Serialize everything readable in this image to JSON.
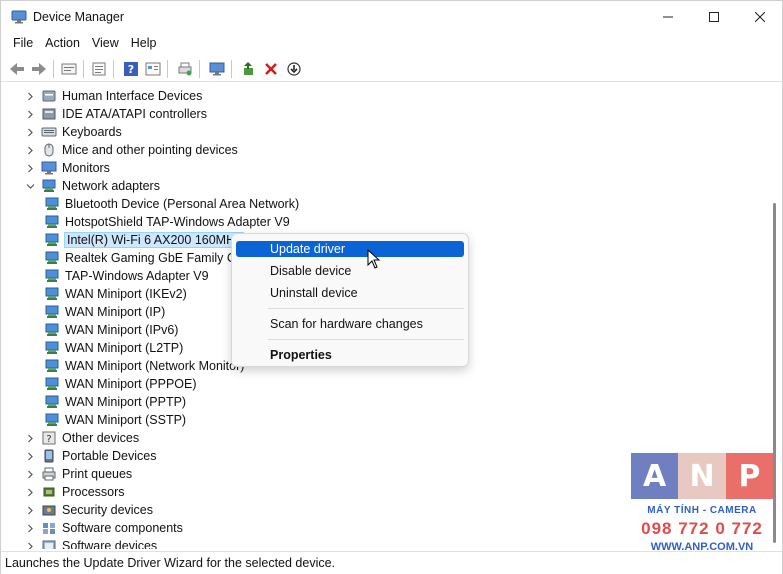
{
  "window": {
    "title": "Device Manager"
  },
  "menu": [
    "File",
    "Action",
    "View",
    "Help"
  ],
  "toolbar": {
    "icons": [
      "back-arrow-icon",
      "forward-arrow-icon",
      "computer-properties-icon",
      "show-hidden-icon",
      "help-icon",
      "view-icon",
      "scan-hardware-icon",
      "monitor-icon",
      "update-driver-icon",
      "uninstall-icon",
      "disable-icon"
    ]
  },
  "tree": {
    "rows": [
      {
        "label": "Human Interface Devices",
        "level": 0,
        "expander": "collapsed",
        "icon": "hid-icon"
      },
      {
        "label": "IDE ATA/ATAPI controllers",
        "level": 0,
        "expander": "collapsed",
        "icon": "ide-controller-icon"
      },
      {
        "label": "Keyboards",
        "level": 0,
        "expander": "collapsed",
        "icon": "keyboard-icon"
      },
      {
        "label": "Mice and other pointing devices",
        "level": 0,
        "expander": "collapsed",
        "icon": "mouse-icon"
      },
      {
        "label": "Monitors",
        "level": 0,
        "expander": "collapsed",
        "icon": "monitor-icon"
      },
      {
        "label": "Network adapters",
        "level": 0,
        "expander": "expanded",
        "icon": "network-adapter-icon"
      },
      {
        "label": "Bluetooth Device (Personal Area Network)",
        "level": 1,
        "icon": "network-adapter-icon"
      },
      {
        "label": "HotspotShield TAP-Windows Adapter V9",
        "level": 1,
        "icon": "network-adapter-icon"
      },
      {
        "label": "Intel(R) Wi-Fi 6 AX200 160MHz",
        "level": 1,
        "icon": "network-adapter-icon",
        "selected": true
      },
      {
        "label": "Realtek Gaming GbE Family Controller",
        "level": 1,
        "icon": "network-adapter-icon"
      },
      {
        "label": "TAP-Windows Adapter V9",
        "level": 1,
        "icon": "network-adapter-icon"
      },
      {
        "label": "WAN Miniport (IKEv2)",
        "level": 1,
        "icon": "network-adapter-icon"
      },
      {
        "label": "WAN Miniport (IP)",
        "level": 1,
        "icon": "network-adapter-icon"
      },
      {
        "label": "WAN Miniport (IPv6)",
        "level": 1,
        "icon": "network-adapter-icon"
      },
      {
        "label": "WAN Miniport (L2TP)",
        "level": 1,
        "icon": "network-adapter-icon"
      },
      {
        "label": "WAN Miniport (Network Monitor)",
        "level": 1,
        "icon": "network-adapter-icon"
      },
      {
        "label": "WAN Miniport (PPPOE)",
        "level": 1,
        "icon": "network-adapter-icon"
      },
      {
        "label": "WAN Miniport (PPTP)",
        "level": 1,
        "icon": "network-adapter-icon"
      },
      {
        "label": "WAN Miniport (SSTP)",
        "level": 1,
        "icon": "network-adapter-icon"
      },
      {
        "label": "Other devices",
        "level": 0,
        "expander": "collapsed",
        "icon": "other-devices-icon"
      },
      {
        "label": "Portable Devices",
        "level": 0,
        "expander": "collapsed",
        "icon": "portable-device-icon"
      },
      {
        "label": "Print queues",
        "level": 0,
        "expander": "collapsed",
        "icon": "printer-icon"
      },
      {
        "label": "Processors",
        "level": 0,
        "expander": "collapsed",
        "icon": "processor-icon"
      },
      {
        "label": "Security devices",
        "level": 0,
        "expander": "collapsed",
        "icon": "security-device-icon"
      },
      {
        "label": "Software components",
        "level": 0,
        "expander": "collapsed",
        "icon": "software-component-icon"
      },
      {
        "label": "Software devices",
        "level": 0,
        "expander": "collapsed",
        "icon": "software-device-icon"
      }
    ]
  },
  "context_menu": {
    "items": [
      {
        "label": "Update driver",
        "highlighted": true
      },
      {
        "label": "Disable device"
      },
      {
        "label": "Uninstall device"
      },
      {
        "separator": true
      },
      {
        "label": "Scan for hardware changes"
      },
      {
        "separator": true
      },
      {
        "label": "Properties",
        "bold": true
      }
    ]
  },
  "status": {
    "text": "Launches the Update Driver Wizard for the selected device."
  },
  "watermark": {
    "letters": [
      "A",
      "N",
      "P"
    ],
    "line1": "MÁY TÍNH - CAMERA",
    "line2": "098 772 0 772",
    "line3": "WWW.ANP.COM.VN"
  }
}
